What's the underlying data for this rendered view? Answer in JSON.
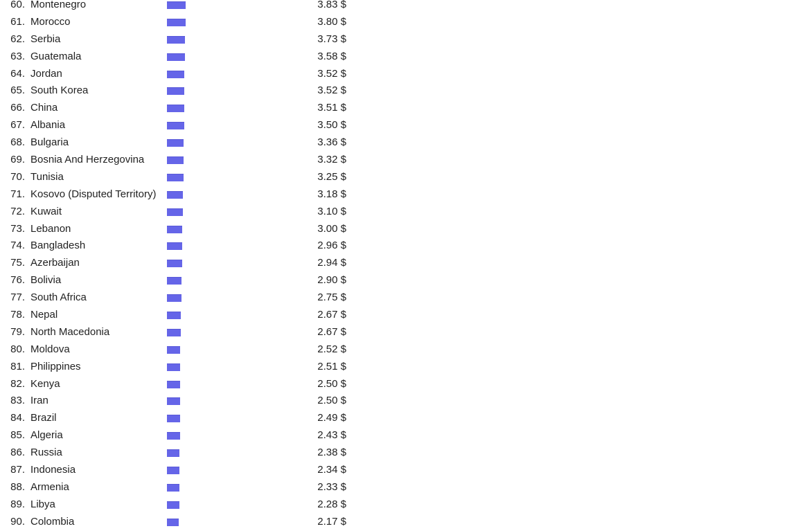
{
  "list": {
    "currency_symbol": "$",
    "bar_color": "#6565e8",
    "text_color": "#222222",
    "background_color": "#ffffff",
    "rows": [
      {
        "rank": "60.",
        "country": "Montenegro",
        "price": "3.83 $",
        "value": 3.83
      },
      {
        "rank": "61.",
        "country": "Morocco",
        "price": "3.80 $",
        "value": 3.8
      },
      {
        "rank": "62.",
        "country": "Serbia",
        "price": "3.73 $",
        "value": 3.73
      },
      {
        "rank": "63.",
        "country": "Guatemala",
        "price": "3.58 $",
        "value": 3.58
      },
      {
        "rank": "64.",
        "country": "Jordan",
        "price": "3.52 $",
        "value": 3.52
      },
      {
        "rank": "65.",
        "country": "South Korea",
        "price": "3.52 $",
        "value": 3.52
      },
      {
        "rank": "66.",
        "country": "China",
        "price": "3.51 $",
        "value": 3.51
      },
      {
        "rank": "67.",
        "country": "Albania",
        "price": "3.50 $",
        "value": 3.5
      },
      {
        "rank": "68.",
        "country": "Bulgaria",
        "price": "3.36 $",
        "value": 3.36
      },
      {
        "rank": "69.",
        "country": "Bosnia And Herzegovina",
        "price": "3.32 $",
        "value": 3.32
      },
      {
        "rank": "70.",
        "country": "Tunisia",
        "price": "3.25 $",
        "value": 3.25
      },
      {
        "rank": "71.",
        "country": "Kosovo (Disputed Territory)",
        "price": "3.18 $",
        "value": 3.18
      },
      {
        "rank": "72.",
        "country": "Kuwait",
        "price": "3.10 $",
        "value": 3.1
      },
      {
        "rank": "73.",
        "country": "Lebanon",
        "price": "3.00 $",
        "value": 3.0
      },
      {
        "rank": "74.",
        "country": "Bangladesh",
        "price": "2.96 $",
        "value": 2.96
      },
      {
        "rank": "75.",
        "country": "Azerbaijan",
        "price": "2.94 $",
        "value": 2.94
      },
      {
        "rank": "76.",
        "country": "Bolivia",
        "price": "2.90 $",
        "value": 2.9
      },
      {
        "rank": "77.",
        "country": "South Africa",
        "price": "2.75 $",
        "value": 2.75
      },
      {
        "rank": "78.",
        "country": "Nepal",
        "price": "2.67 $",
        "value": 2.67
      },
      {
        "rank": "79.",
        "country": "North Macedonia",
        "price": "2.67 $",
        "value": 2.67
      },
      {
        "rank": "80.",
        "country": "Moldova",
        "price": "2.52 $",
        "value": 2.52
      },
      {
        "rank": "81.",
        "country": "Philippines",
        "price": "2.51 $",
        "value": 2.51
      },
      {
        "rank": "82.",
        "country": "Kenya",
        "price": "2.50 $",
        "value": 2.5
      },
      {
        "rank": "83.",
        "country": "Iran",
        "price": "2.50 $",
        "value": 2.5
      },
      {
        "rank": "84.",
        "country": "Brazil",
        "price": "2.49 $",
        "value": 2.49
      },
      {
        "rank": "85.",
        "country": "Algeria",
        "price": "2.43 $",
        "value": 2.43
      },
      {
        "rank": "86.",
        "country": "Russia",
        "price": "2.38 $",
        "value": 2.38
      },
      {
        "rank": "87.",
        "country": "Indonesia",
        "price": "2.34 $",
        "value": 2.34
      },
      {
        "rank": "88.",
        "country": "Armenia",
        "price": "2.33 $",
        "value": 2.33
      },
      {
        "rank": "89.",
        "country": "Libya",
        "price": "2.28 $",
        "value": 2.28
      },
      {
        "rank": "90.",
        "country": "Colombia",
        "price": "2.17 $",
        "value": 2.17
      }
    ]
  },
  "chart_data": {
    "type": "bar",
    "title": "",
    "xlabel": "",
    "ylabel": "",
    "orientation": "horizontal",
    "unit": "USD",
    "categories": [
      "Montenegro",
      "Morocco",
      "Serbia",
      "Guatemala",
      "Jordan",
      "South Korea",
      "China",
      "Albania",
      "Bulgaria",
      "Bosnia And Herzegovina",
      "Tunisia",
      "Kosovo (Disputed Territory)",
      "Kuwait",
      "Lebanon",
      "Bangladesh",
      "Azerbaijan",
      "Bolivia",
      "South Africa",
      "Nepal",
      "North Macedonia",
      "Moldova",
      "Philippines",
      "Kenya",
      "Iran",
      "Brazil",
      "Algeria",
      "Russia",
      "Indonesia",
      "Armenia",
      "Libya",
      "Colombia"
    ],
    "values": [
      3.83,
      3.8,
      3.73,
      3.58,
      3.52,
      3.52,
      3.51,
      3.5,
      3.36,
      3.32,
      3.25,
      3.18,
      3.1,
      3.0,
      2.96,
      2.94,
      2.9,
      2.75,
      2.67,
      2.67,
      2.52,
      2.51,
      2.5,
      2.5,
      2.49,
      2.43,
      2.38,
      2.34,
      2.33,
      2.28,
      2.17
    ],
    "ranks": [
      60,
      61,
      62,
      63,
      64,
      65,
      66,
      67,
      68,
      69,
      70,
      71,
      72,
      73,
      74,
      75,
      76,
      77,
      78,
      79,
      80,
      81,
      82,
      83,
      84,
      85,
      86,
      87,
      88,
      89,
      90
    ],
    "xlim": [
      0,
      3.83
    ],
    "grid": false,
    "legend": "none",
    "bar_color": "#6565e8"
  }
}
